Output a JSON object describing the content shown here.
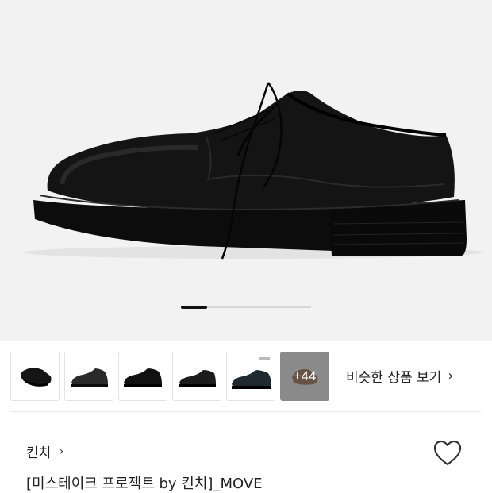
{
  "gallery": {
    "current_slide": 1,
    "thumbnails": [
      {
        "name": "thumbnail-1"
      },
      {
        "name": "thumbnail-2"
      },
      {
        "name": "thumbnail-3"
      },
      {
        "name": "thumbnail-4"
      },
      {
        "name": "thumbnail-5"
      }
    ],
    "more_count_label": "+44"
  },
  "similar": {
    "label": "비슷한 상품 보기",
    "chevron": "›"
  },
  "product": {
    "brand": "킨치",
    "brand_chevron": "›",
    "title": "[미스테이크 프로젝트 by 킨치]_MOVE",
    "wishlist_icon": "heart-outline-icon"
  },
  "colors": {
    "hero_bg": "#f2f2f2",
    "shoe": "#111111"
  }
}
